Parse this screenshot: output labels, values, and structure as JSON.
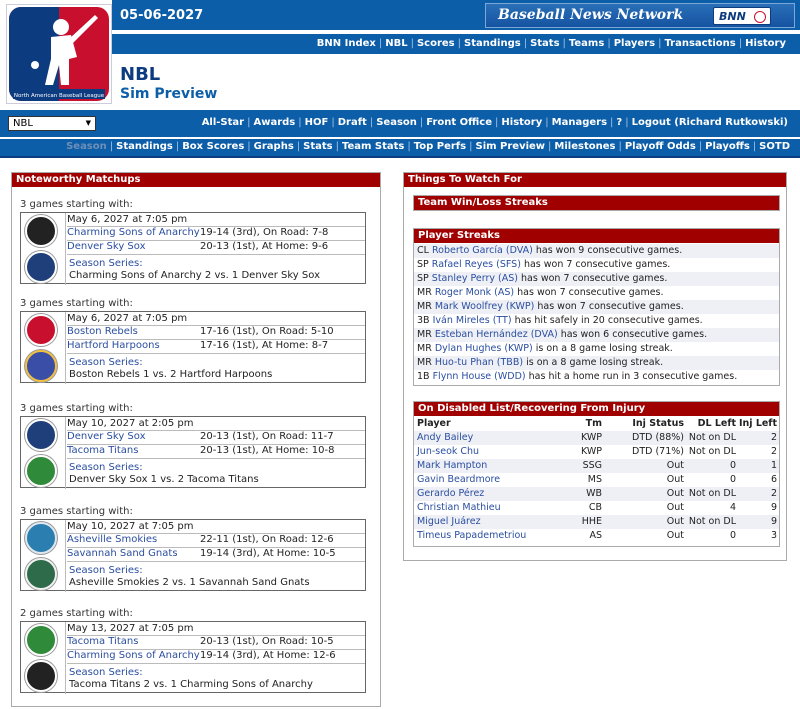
{
  "header": {
    "date": "05-06-2027",
    "network_title": "Baseball News Network",
    "network_badge": "BNN",
    "logo_text": "North American Baseball League",
    "league_name": "NBL",
    "page_title": "Sim Preview"
  },
  "nav_top": [
    "BNN Index",
    "NBL",
    "Scores",
    "Standings",
    "Stats",
    "Teams",
    "Players",
    "Transactions",
    "History"
  ],
  "league_select": {
    "value": "NBL"
  },
  "nav_second": [
    "All-Star",
    "Awards",
    "HOF",
    "Draft",
    "Season",
    "Front Office",
    "History",
    "Managers",
    "?",
    "Logout (Richard Rutkowski)"
  ],
  "nav_third": [
    "Season",
    "Standings",
    "Box Scores",
    "Graphs",
    "Stats",
    "Team Stats",
    "Top Perfs",
    "Sim Preview",
    "Milestones",
    "Playoff Odds",
    "Playoffs",
    "SOTD"
  ],
  "matchups": {
    "title": "Noteworthy Matchups",
    "series_label": "Season Series:",
    "items": [
      {
        "header": "3 games starting with:",
        "date": "May 6, 2027 at 7:05 pm",
        "away": "Charming Sons of Anarchy",
        "away_rec": "19-14 (3rd), On Road: 7-8",
        "home": "Denver Sky Sox",
        "home_rec": "20-13 (1st), At Home: 9-6",
        "series": "Charming Sons of Anarchy 2 vs. 1 Denver Sky Sox"
      },
      {
        "header": "3 games starting with:",
        "date": "May 6, 2027 at 7:05 pm",
        "away": "Boston Rebels",
        "away_rec": "17-16 (1st), On Road: 5-10",
        "home": "Hartford Harpoons",
        "home_rec": "17-16 (1st), At Home: 8-7",
        "series": "Boston Rebels 1 vs. 2 Hartford Harpoons"
      },
      {
        "header": "3 games starting with:",
        "date": "May 10, 2027 at 2:05 pm",
        "away": "Denver Sky Sox",
        "away_rec": "20-13 (1st), On Road: 11-7",
        "home": "Tacoma Titans",
        "home_rec": "20-13 (1st), At Home: 10-8",
        "series": "Denver Sky Sox 1 vs. 2 Tacoma Titans"
      },
      {
        "header": "3 games starting with:",
        "date": "May 10, 2027 at 7:05 pm",
        "away": "Asheville Smokies",
        "away_rec": "22-11 (1st), On Road: 12-6",
        "home": "Savannah Sand Gnats",
        "home_rec": "19-14 (3rd), At Home: 10-5",
        "series": "Asheville Smokies 2 vs. 1 Savannah Sand Gnats"
      },
      {
        "header": "2 games starting with:",
        "date": "May 13, 2027 at 7:05 pm",
        "away": "Tacoma Titans",
        "away_rec": "20-13 (1st), On Road: 10-5",
        "home": "Charming Sons of Anarchy",
        "home_rec": "19-14 (3rd), At Home: 12-6",
        "series": "Tacoma Titans 2 vs. 1 Charming Sons of Anarchy"
      }
    ]
  },
  "things_to_watch": {
    "title": "Things To Watch For",
    "team_streaks_title": "Team Win/Loss Streaks",
    "player_streaks_title": "Player Streaks",
    "player_streaks": [
      {
        "pos": "CL",
        "name": "Roberto García (DVA)",
        "text": "has won 9 consecutive games."
      },
      {
        "pos": "SP",
        "name": "Rafael Reyes (SFS)",
        "text": "has won 7 consecutive games."
      },
      {
        "pos": "SP",
        "name": "Stanley Perry (AS)",
        "text": "has won 7 consecutive games."
      },
      {
        "pos": "MR",
        "name": "Roger Monk (AS)",
        "text": "has won 7 consecutive games."
      },
      {
        "pos": "MR",
        "name": "Mark Woolfrey (KWP)",
        "text": "has won 7 consecutive games."
      },
      {
        "pos": "3B",
        "name": "Iván Mireles (TT)",
        "text": "has hit safely in 20 consecutive games."
      },
      {
        "pos": "MR",
        "name": "Esteban Hernández (DVA)",
        "text": "has won 6 consecutive games."
      },
      {
        "pos": "MR",
        "name": "Dylan Hughes (KWP)",
        "text": "is on a 8 game losing streak."
      },
      {
        "pos": "MR",
        "name": "Huo-tu Phan (TBB)",
        "text": "is on a 8 game losing streak."
      },
      {
        "pos": "1B",
        "name": "Flynn House (WDD)",
        "text": "has hit a home run in 3 consecutive games."
      }
    ],
    "injury_title": "On Disabled List/Recovering From Injury",
    "injury_headers": {
      "player": "Player",
      "tm": "Tm",
      "status": "Inj Status",
      "dl": "DL Left",
      "inj": "Inj Left"
    },
    "injuries": [
      {
        "player": "Andy Bailey",
        "tm": "KWP",
        "status": "DTD (88%)",
        "dl": "Not on DL",
        "inj": "2"
      },
      {
        "player": "Jun-seok Chu",
        "tm": "KWP",
        "status": "DTD (71%)",
        "dl": "Not on DL",
        "inj": "2"
      },
      {
        "player": "Mark Hampton",
        "tm": "SSG",
        "status": "Out",
        "dl": "0",
        "inj": "1"
      },
      {
        "player": "Gavin Beardmore",
        "tm": "MS",
        "status": "Out",
        "dl": "0",
        "inj": "6"
      },
      {
        "player": "Gerardo Pérez",
        "tm": "WB",
        "status": "Out",
        "dl": "Not on DL",
        "inj": "2"
      },
      {
        "player": "Christian Mathieu",
        "tm": "CB",
        "status": "Out",
        "dl": "4",
        "inj": "9"
      },
      {
        "player": "Miguel Juárez",
        "tm": "HHE",
        "status": "Out",
        "dl": "Not on DL",
        "inj": "9"
      },
      {
        "player": "Timeus Papademetriou",
        "tm": "AS",
        "status": "Out",
        "dl": "0",
        "inj": "3"
      }
    ]
  },
  "colors": {
    "nav_blue": "#0d5ea8",
    "panel_red": "#a00000",
    "link_blue": "#2a4ea0",
    "row_alt": "#eef0f6"
  }
}
